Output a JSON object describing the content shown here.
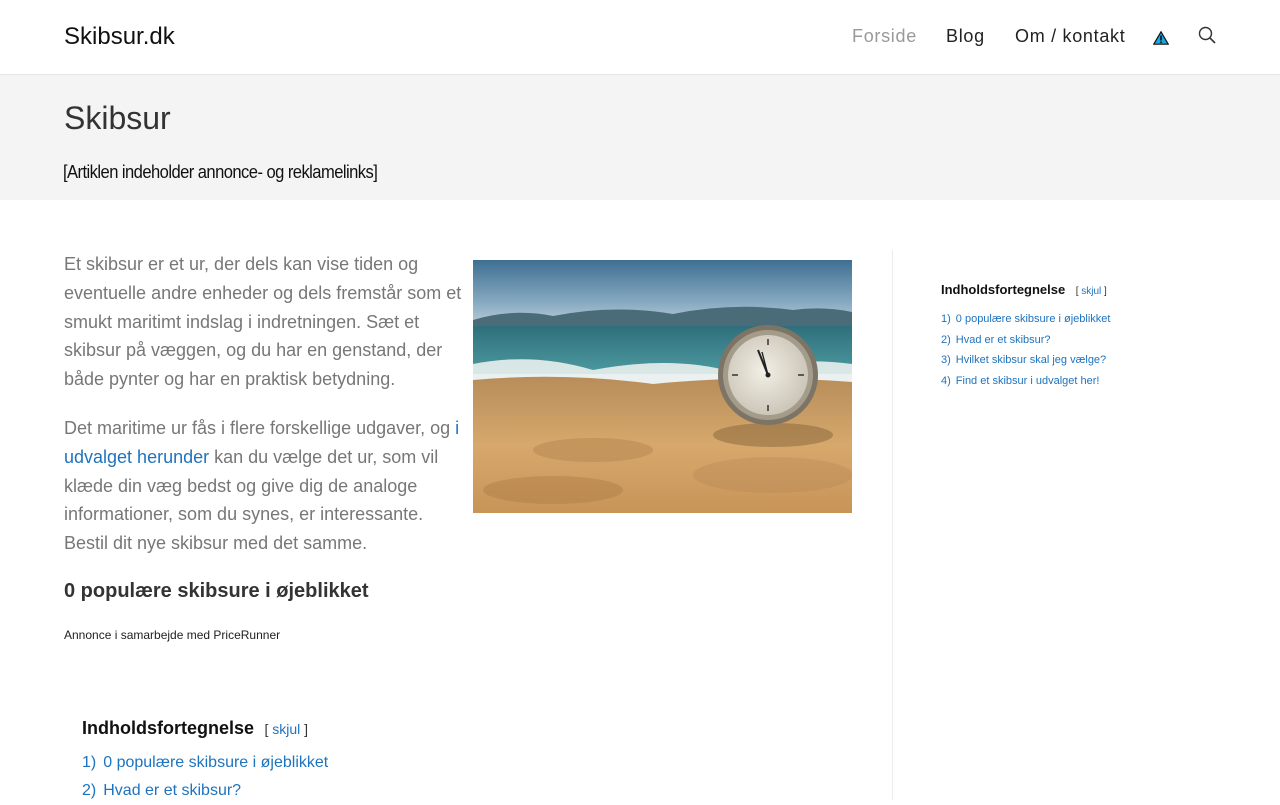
{
  "header": {
    "logo": "Skibsur.dk",
    "nav": [
      {
        "label": "Forside"
      },
      {
        "label": "Blog"
      },
      {
        "label": "Om / kontakt"
      }
    ]
  },
  "page": {
    "title": "Skibsur",
    "disclaimer": "[Artiklen indeholder annonce- og reklamelinks]"
  },
  "article": {
    "p1": "Et skibsur er et ur, der dels kan vise tiden og eventuelle andre enheder og dels fremstår som et smukt maritimt indslag i indretningen. Sæt et skibsur på væggen, og du har en genstand, der både pynter og har en praktisk betydning.",
    "p2_before": "Det maritime ur fås i flere forskellige udgaver, og ",
    "p2_link": "i udvalget herunder",
    "p2_after": " kan du vælge det ur, som vil klæde din væg bedst og give dig de analoge informationer, som du synes, er interessante. Bestil dit nye skibsur med det samme.",
    "heading": "0 populære skibsure i øjeblikket",
    "annonce": "Annonce i samarbejde med PriceRunner"
  },
  "toc": {
    "title": "Indholdsfortegnelse",
    "bracket_open": "[",
    "toggle": "skjul",
    "bracket_close": "]",
    "items": [
      {
        "num": "1)",
        "label": "0 populære skibsure i øjeblikket"
      },
      {
        "num": "2)",
        "label": "Hvad er et skibsur?"
      },
      {
        "num": "3)",
        "label": "Hvilket skibsur skal jeg vælge?"
      },
      {
        "num": "4)",
        "label": "Find et skibsur i udvalget her!"
      }
    ]
  },
  "icons": {
    "flag": "warning-flag-icon",
    "search": "search-icon"
  },
  "colors": {
    "link": "#1e73be",
    "active_nav": "#999999",
    "page_header_bg": "#f4f4f4"
  }
}
